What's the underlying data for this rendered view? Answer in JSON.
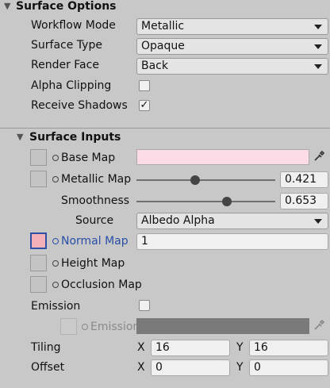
{
  "surface_options": {
    "title": "Surface Options",
    "workflow_mode": {
      "label": "Workflow Mode",
      "value": "Metallic"
    },
    "surface_type": {
      "label": "Surface Type",
      "value": "Opaque"
    },
    "render_face": {
      "label": "Render Face",
      "value": "Back"
    },
    "alpha_clipping": {
      "label": "Alpha Clipping",
      "checked": false
    },
    "receive_shadows": {
      "label": "Receive Shadows",
      "checked": true,
      "check_glyph": "✓"
    }
  },
  "surface_inputs": {
    "title": "Surface Inputs",
    "base_map": {
      "label": "Base Map",
      "color": "#fadbe6"
    },
    "metallic_map": {
      "label": "Metallic Map",
      "value": "0.421",
      "fraction": 0.421
    },
    "smoothness": {
      "label": "Smoothness",
      "value": "0.653",
      "fraction": 0.653
    },
    "source": {
      "label": "Source",
      "value": "Albedo Alpha"
    },
    "normal_map": {
      "label": "Normal Map",
      "value": "1",
      "thumb_color": "#f4b0b8"
    },
    "height_map": {
      "label": "Height Map"
    },
    "occlusion_map": {
      "label": "Occlusion Map"
    },
    "emission": {
      "label": "Emission",
      "checked": false
    },
    "emission_map": {
      "label": "Emission Map",
      "color": "#7a7a7a"
    },
    "tiling": {
      "label": "Tiling",
      "x_label": "X",
      "x": "16",
      "y_label": "Y",
      "y": "16"
    },
    "offset": {
      "label": "Offset",
      "x_label": "X",
      "x": "0",
      "y_label": "Y",
      "y": "0"
    }
  },
  "icons": {
    "foldout": "triangle-down",
    "eyedropper": "eyedropper",
    "texture_picker": "object-picker"
  }
}
